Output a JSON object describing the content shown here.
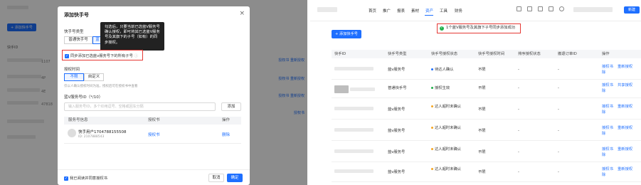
{
  "left": {
    "background": {
      "add_button": "+ 添加快手号",
      "col_label": "快手ID",
      "row_numbers": [
        "1107",
        "4P",
        "4E",
        "47818"
      ],
      "right_links": [
        [
          "授权书",
          "重新授权"
        ],
        [
          "授权书",
          "重新授权"
        ],
        [
          "授权书",
          "重新授权"
        ],
        [
          "授权书"
        ]
      ]
    },
    "modal": {
      "title": "添加快手号",
      "close": "×",
      "type_label": "快手号类型",
      "type_options": [
        "普通快手号",
        "蓝"
      ],
      "tooltip": "勾选后，只要当前已选蓝V服务号确认授权，即可将其已选蓝V服务号及其旗下的子号（如有）的同步授权。",
      "sync_checkbox": "同步添加已选蓝v服务号下的所有子号",
      "auth_time_label": "授权时间",
      "auth_time_options": [
        "不限",
        "自定义"
      ],
      "hint": "仅以人确认授权时间为准，授权后可在授权书中查看",
      "vid_label": "蓝V服务号ID（*/10）",
      "input_placeholder": "输入服务号ID，多个ID用逗号、空格或回车分隔",
      "add_button": "添加",
      "table_headers": [
        "服务号信息",
        "授权书",
        "操作"
      ],
      "table_row": {
        "name": "快手用户1704788155508",
        "id": "ID: 2107888543",
        "auth_link": "授权书",
        "delete": "删除"
      },
      "agree_label": "我已阅读并同意授权书",
      "cancel": "取消",
      "confirm": "确定"
    }
  },
  "right": {
    "nav": {
      "items": [
        "首页",
        "推广",
        "报表",
        "素材",
        "资产",
        "工具",
        "财务"
      ],
      "active_index": 4,
      "new_button": "新建"
    },
    "toast": "1个蓝V服务号及其旗下子号同步添加成功",
    "add_button": "+ 添加快手号",
    "table": {
      "headers": [
        "快手ID",
        "快手号类型",
        "快手号授权状态",
        "快手号授权时间",
        "排序授权状态",
        "撤退订单ID",
        "操作"
      ],
      "rows": [
        {
          "type": "蓝v服务号",
          "status": "待达人确认",
          "status_color": "#1e6fff",
          "time": "不限",
          "sort": "-",
          "order": "-",
          "ops": [
            "授权书",
            "重新授权",
            "除"
          ]
        },
        {
          "type": "普通快手号",
          "status": "授权生效",
          "status_color": "#22b14c",
          "time": "不限",
          "sort": "-",
          "order": "-",
          "ops": [
            "授权书",
            "共享授权",
            "除"
          ]
        },
        {
          "type": "蓝v服务号",
          "status": "达人超时未确认",
          "status_color": "#f5a623",
          "time": "不限",
          "sort": "-",
          "order": "-",
          "ops": [
            "授权书",
            "重新授权",
            "除"
          ]
        },
        {
          "type": "蓝v服务号",
          "status": "达人超时未确认",
          "status_color": "#f5a623",
          "time": "不限",
          "sort": "-",
          "order": "-",
          "ops": [
            "授权书",
            "重新授权",
            "除"
          ]
        },
        {
          "type": "蓝v服务号",
          "status": "达人超时未确认",
          "status_color": "#f5a623",
          "time": "不限",
          "sort": "-",
          "order": "-",
          "ops": [
            "授权书",
            "重新授权",
            "除"
          ]
        },
        {
          "type": "蓝v服务号",
          "status": "达人超时未确认",
          "status_color": "#f5a623",
          "time": "不限",
          "sort": "-",
          "order": "-",
          "ops": [
            "授权书",
            "重新授权",
            "除"
          ]
        }
      ]
    }
  }
}
